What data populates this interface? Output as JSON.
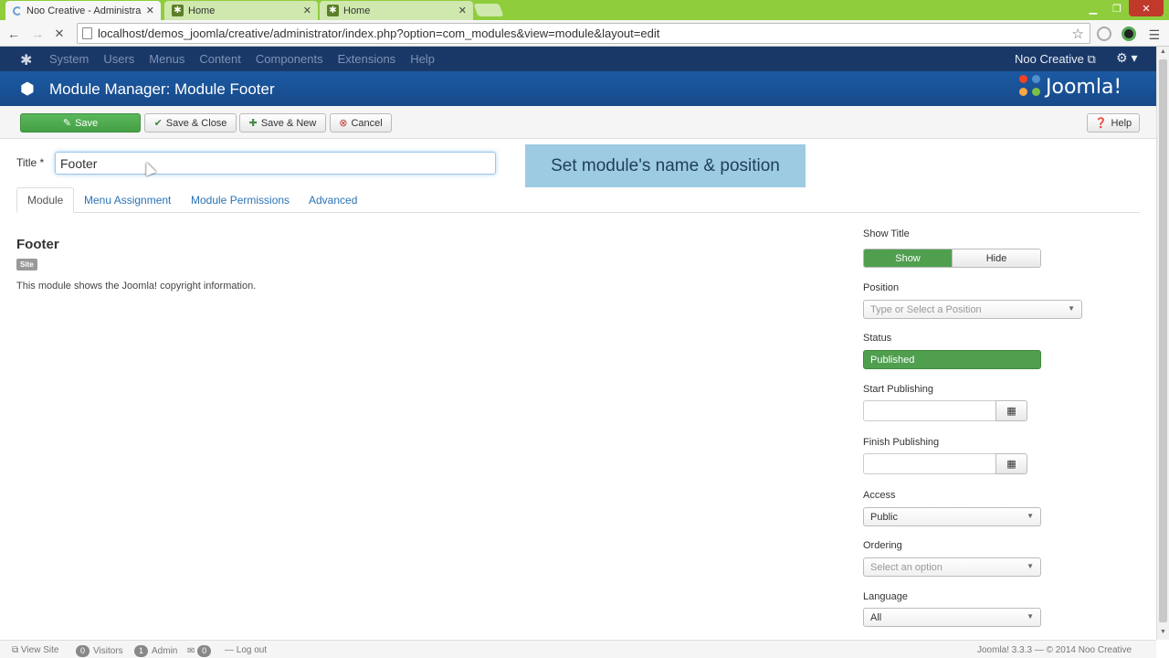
{
  "browser": {
    "tabs": [
      {
        "title": "Noo Creative - Administra"
      },
      {
        "title": "Home"
      },
      {
        "title": "Home"
      }
    ],
    "url": "localhost/demos_joomla/creative/administrator/index.php?option=com_modules&view=module&layout=edit"
  },
  "topnav": {
    "menu": [
      "System",
      "Users",
      "Menus",
      "Content",
      "Components",
      "Extensions",
      "Help"
    ],
    "user": "Noo Creative"
  },
  "header": {
    "title": "Module Manager: Module Footer",
    "brand": "Joomla!"
  },
  "toolbar": {
    "save": "Save",
    "save_close": "Save & Close",
    "save_new": "Save & New",
    "cancel": "Cancel",
    "help": "Help"
  },
  "form": {
    "title_label": "Title *",
    "title_value": "Footer",
    "callout": "Set module's name & position"
  },
  "tabs": [
    "Module",
    "Menu Assignment",
    "Module Permissions",
    "Advanced"
  ],
  "module": {
    "name": "Footer",
    "badge": "Site",
    "description": "This module shows the Joomla! copyright information."
  },
  "options": {
    "show_title_label": "Show Title",
    "show": "Show",
    "hide": "Hide",
    "position_label": "Position",
    "position_placeholder": "Type or Select a Position",
    "status_label": "Status",
    "status_value": "Published",
    "start_label": "Start Publishing",
    "finish_label": "Finish Publishing",
    "access_label": "Access",
    "access_value": "Public",
    "ordering_label": "Ordering",
    "ordering_value": "Select an option",
    "language_label": "Language",
    "language_value": "All"
  },
  "footer": {
    "view_site": "View Site",
    "visitors_count": "0",
    "visitors": "Visitors",
    "admin_count": "1",
    "admin": "Admin",
    "messages_count": "0",
    "logout": "Log out",
    "version": "Joomla! 3.3.3 — © 2014 Noo Creative"
  },
  "colors": {
    "navbar": "#1a3867",
    "header": "#17539a",
    "success": "#4f9f4f",
    "callout": "#9dcbe1"
  }
}
